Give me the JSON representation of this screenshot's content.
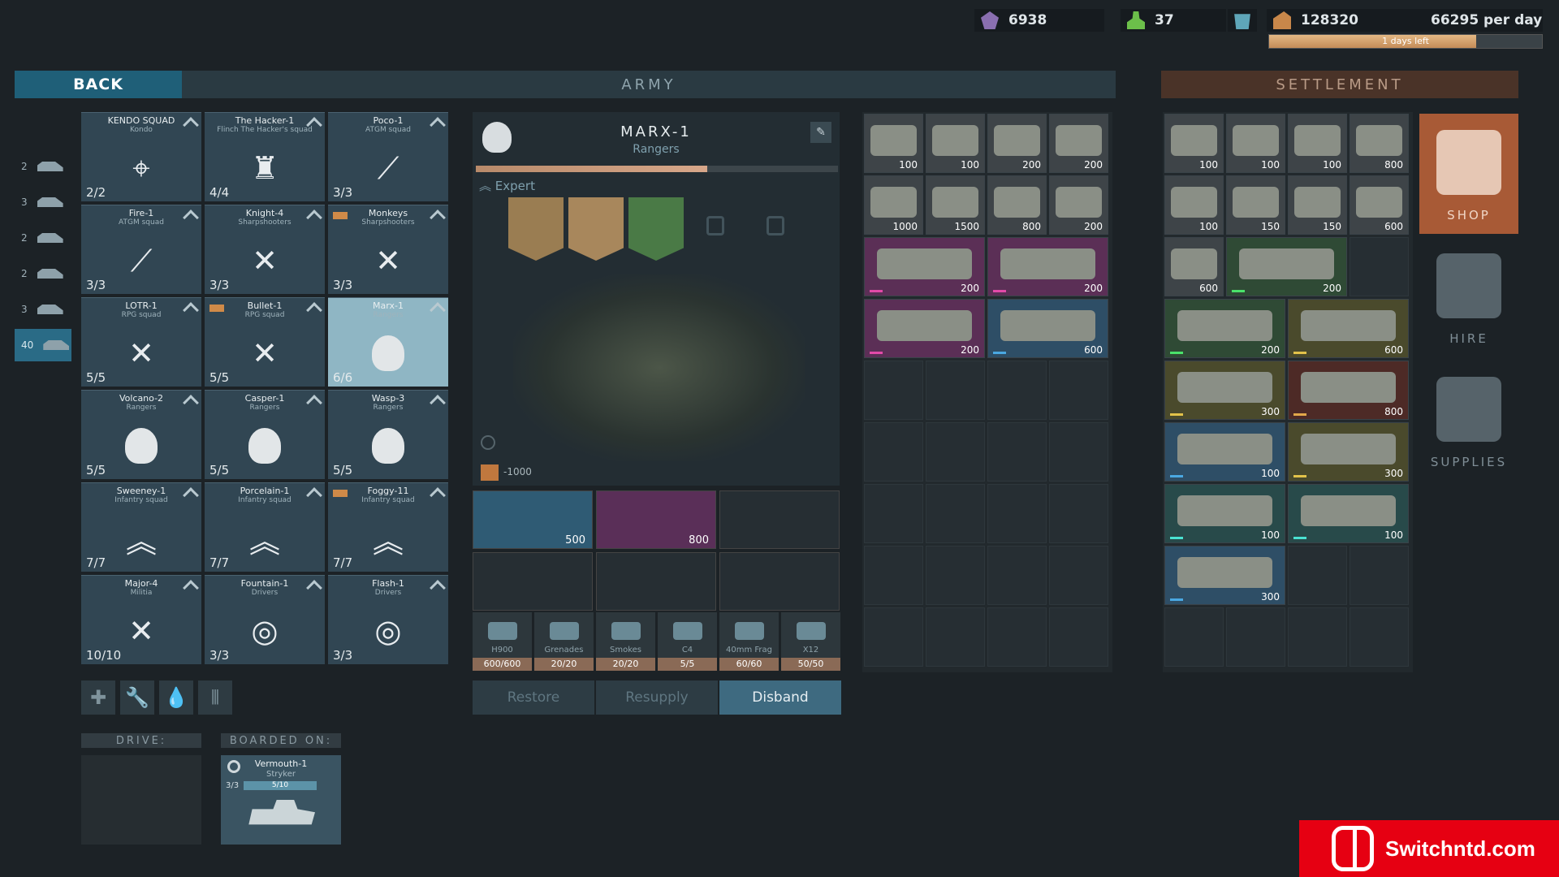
{
  "topbar": {
    "gems": "6938",
    "population": "37",
    "money": "128320",
    "income": "66295 per day",
    "days_left": "1 days left",
    "days_fraction": 0.76
  },
  "headers": {
    "back": "BACK",
    "army": "ARMY",
    "settlement": "SETTLEMENT"
  },
  "side_tabs": [
    {
      "count": "2",
      "icon": "helicopter-icon"
    },
    {
      "count": "3",
      "icon": "tank-destroyer-icon"
    },
    {
      "count": "2",
      "icon": "tank-icon"
    },
    {
      "count": "2",
      "icon": "apc-icon"
    },
    {
      "count": "3",
      "icon": "artillery-icon"
    },
    {
      "count": "40",
      "icon": "soldier-icon"
    }
  ],
  "squads": [
    {
      "name": "KENDO SQUAD",
      "type": "Kondo",
      "count": "2/2",
      "icon": "crosshair-icon"
    },
    {
      "name": "The Hacker-1",
      "type": "Flinch The Hacker's squad",
      "count": "4/4",
      "icon": "tower-icon"
    },
    {
      "name": "Poco-1",
      "type": "ATGM squad",
      "count": "3/3",
      "icon": "rocket-icon"
    },
    {
      "name": "Fire-1",
      "type": "ATGM squad",
      "count": "3/3",
      "icon": "rocket-icon"
    },
    {
      "name": "Knight-4",
      "type": "Sharpshooters",
      "count": "3/3",
      "icon": "crossed-rifles-icon"
    },
    {
      "name": "Monkeys",
      "type": "Sharpshooters",
      "count": "3/3",
      "icon": "crossed-rifles-icon"
    },
    {
      "name": "LOTR-1",
      "type": "RPG squad",
      "count": "5/5",
      "icon": "crossed-rpg-icon"
    },
    {
      "name": "Bullet-1",
      "type": "RPG squad",
      "count": "5/5",
      "icon": "crossed-rpg-icon"
    },
    {
      "name": "Marx-1",
      "type": "Rangers",
      "count": "6/6",
      "icon": "skull-icon"
    },
    {
      "name": "Volcano-2",
      "type": "Rangers",
      "count": "5/5",
      "icon": "skull-icon"
    },
    {
      "name": "Casper-1",
      "type": "Rangers",
      "count": "5/5",
      "icon": "skull-icon"
    },
    {
      "name": "Wasp-3",
      "type": "Rangers",
      "count": "5/5",
      "icon": "skull-icon"
    },
    {
      "name": "Sweeney-1",
      "type": "Infantry squad",
      "count": "7/7",
      "icon": "chevron-icon"
    },
    {
      "name": "Porcelain-1",
      "type": "Infantry squad",
      "count": "7/7",
      "icon": "chevron-icon"
    },
    {
      "name": "Foggy-11",
      "type": "Infantry squad",
      "count": "7/7",
      "icon": "chevron-icon"
    },
    {
      "name": "Major-4",
      "type": "Militia",
      "count": "10/10",
      "icon": "crossed-rifles-icon"
    },
    {
      "name": "Fountain-1",
      "type": "Drivers",
      "count": "3/3",
      "icon": "steering-wheel-icon"
    },
    {
      "name": "Flash-1",
      "type": "Drivers",
      "count": "3/3",
      "icon": "steering-wheel-icon"
    }
  ],
  "labels": {
    "drive": "DRIVE:",
    "boarded": "BOARDED ON:"
  },
  "vehicle": {
    "name": "Vermouth-1",
    "type": "Stryker",
    "crew": "3/3",
    "capacity": "5/10"
  },
  "detail": {
    "name": "MARX-1",
    "type": "Rangers",
    "rank": "Expert",
    "supply": "-1000"
  },
  "weapons": [
    {
      "value": "500"
    },
    {
      "value": "800"
    }
  ],
  "ammo": [
    {
      "name": "H900",
      "qty": "600/600"
    },
    {
      "name": "Grenades",
      "qty": "20/20"
    },
    {
      "name": "Smokes",
      "qty": "20/20"
    },
    {
      "name": "C4",
      "qty": "5/5"
    },
    {
      "name": "40mm Frag",
      "qty": "60/60"
    },
    {
      "name": "X12",
      "qty": "50/50"
    }
  ],
  "actions": {
    "restore": "Restore",
    "resupply": "Resupply",
    "disband": "Disband"
  },
  "army_items": [
    {
      "v": "100"
    },
    {
      "v": "100"
    },
    {
      "v": "200"
    },
    {
      "v": "200"
    },
    {
      "v": "1000"
    },
    {
      "v": "1500"
    },
    {
      "v": "800"
    },
    {
      "v": "200"
    },
    {
      "v": "200"
    },
    {
      "v": "200"
    },
    {
      "v": "200"
    },
    {
      "v": "600"
    }
  ],
  "settle_items": [
    {
      "v": "100"
    },
    {
      "v": "100"
    },
    {
      "v": "100"
    },
    {
      "v": "800"
    },
    {
      "v": "100"
    },
    {
      "v": "150"
    },
    {
      "v": "150"
    },
    {
      "v": "600"
    },
    {
      "v": "600"
    },
    {
      "v": "200"
    },
    {
      "v": "200"
    },
    {
      "v": "600"
    },
    {
      "v": "300"
    },
    {
      "v": "800"
    },
    {
      "v": "100"
    },
    {
      "v": "300"
    },
    {
      "v": "100"
    },
    {
      "v": "100"
    },
    {
      "v": "300"
    }
  ],
  "right_menu": {
    "shop": "SHOP",
    "hire": "HIRE",
    "supplies": "SUPPLIES"
  },
  "watermark": "Switchntd.com"
}
